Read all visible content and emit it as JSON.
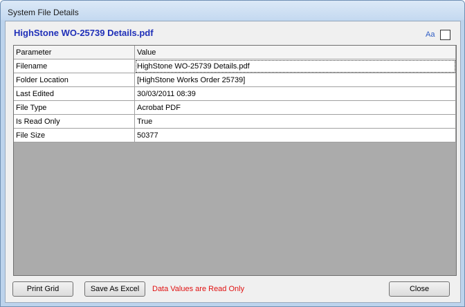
{
  "window": {
    "title": "System File Details"
  },
  "header": {
    "doc_title": "HighStone WO-25739 Details.pdf",
    "font_toggle_label": "Aa"
  },
  "grid": {
    "columns": [
      "Parameter",
      "Value"
    ],
    "rows": [
      {
        "parameter": "Filename",
        "value": "HighStone WO-25739 Details.pdf"
      },
      {
        "parameter": "Folder Location",
        "value": "[HighStone Works Order 25739]"
      },
      {
        "parameter": "Last Edited",
        "value": "30/03/2011 08:39"
      },
      {
        "parameter": "File Type",
        "value": "Acrobat PDF"
      },
      {
        "parameter": "Is Read Only",
        "value": "True"
      },
      {
        "parameter": "File Size",
        "value": "50377"
      }
    ]
  },
  "footer": {
    "print_label": "Print Grid",
    "excel_label": "Save As Excel",
    "status_text": "Data Values are Read Only",
    "close_label": "Close"
  }
}
